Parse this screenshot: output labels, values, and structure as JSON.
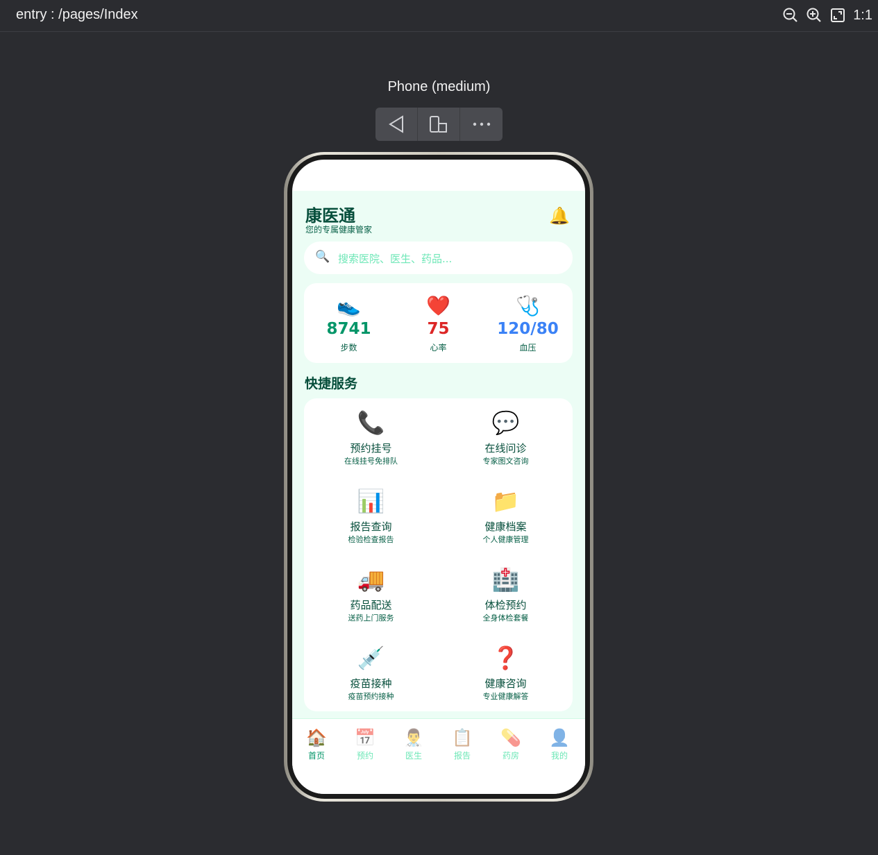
{
  "ide": {
    "route": "entry : /pages/Index",
    "device_label": "Phone (medium)",
    "zoom_reset_label": "1:1"
  },
  "app": {
    "title": "康医通",
    "subtitle": "您的专属健康管家",
    "notification_icon": "🔔",
    "search": {
      "icon": "🔍",
      "placeholder": "搜索医院、医生、药品..."
    },
    "stats": [
      {
        "icon": "👟",
        "value": "8741",
        "label": "步数",
        "color": "#059669"
      },
      {
        "icon": "❤️",
        "value": "75",
        "label": "心率",
        "color": "#dc2626"
      },
      {
        "icon": "🩺",
        "value": "120/80",
        "label": "血压",
        "color": "#3b82f6"
      }
    ],
    "section_title": "快捷服务",
    "services": [
      {
        "icon": "📞",
        "name": "预约挂号",
        "desc": "在线挂号免排队"
      },
      {
        "icon": "💬",
        "name": "在线问诊",
        "desc": "专家图文咨询"
      },
      {
        "icon": "📊",
        "name": "报告查询",
        "desc": "检验检查报告"
      },
      {
        "icon": "📁",
        "name": "健康档案",
        "desc": "个人健康管理"
      },
      {
        "icon": "🚚",
        "name": "药品配送",
        "desc": "送药上门服务"
      },
      {
        "icon": "🏥",
        "name": "体检预约",
        "desc": "全身体检套餐"
      },
      {
        "icon": "💉",
        "name": "疫苗接种",
        "desc": "疫苗预约接种"
      },
      {
        "icon": "❓",
        "name": "健康咨询",
        "desc": "专业健康解答"
      }
    ],
    "tabs": [
      {
        "icon": "🏠",
        "label": "首页",
        "active": true
      },
      {
        "icon": "📅",
        "label": "预约",
        "active": false
      },
      {
        "icon": "👨‍⚕️",
        "label": "医生",
        "active": false
      },
      {
        "icon": "📋",
        "label": "报告",
        "active": false
      },
      {
        "icon": "💊",
        "label": "药房",
        "active": false
      },
      {
        "icon": "👤",
        "label": "我的",
        "active": false
      }
    ]
  }
}
